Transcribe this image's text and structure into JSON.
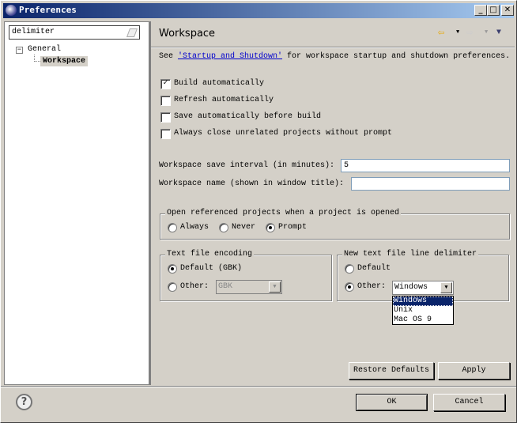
{
  "window": {
    "title": "Preferences",
    "minimize": "_",
    "maximize": "□",
    "close": "✕"
  },
  "sidebar": {
    "filter_value": "delimiter",
    "tree": [
      {
        "label": "General",
        "expanded": true,
        "toggle": "−",
        "children": [
          {
            "label": "Workspace",
            "selected": true
          }
        ]
      }
    ]
  },
  "page": {
    "title": "Workspace",
    "nav_back_icon": "back-arrow-icon",
    "nav_forward_icon": "forward-arrow-icon",
    "menu_icon": "view-menu-icon",
    "intro_prefix": "See ",
    "intro_link": "'Startup and Shutdown'",
    "intro_suffix": " for workspace startup and shutdown preferences.",
    "checkboxes": [
      {
        "label": "Build automatically",
        "checked": true
      },
      {
        "label": "Refresh automatically",
        "checked": false
      },
      {
        "label": "Save automatically before build",
        "checked": false
      },
      {
        "label": "Always close unrelated projects without prompt",
        "checked": false
      }
    ],
    "save_interval_label": "Workspace save interval (in minutes):",
    "save_interval_value": "5",
    "workspace_name_label": "Workspace name (shown in window title):",
    "workspace_name_value": "",
    "open_projects": {
      "title": "Open referenced projects when a project is opened",
      "options": [
        "Always",
        "Never",
        "Prompt"
      ],
      "selected": "Prompt"
    },
    "encoding": {
      "title": "Text file encoding",
      "default_label": "Default (GBK)",
      "other_label": "Other:",
      "other_value": "GBK",
      "selected": "Default"
    },
    "delimiter": {
      "title": "New text file line delimiter",
      "default_label": "Default",
      "other_label": "Other:",
      "other_value": "Windows",
      "selected": "Other",
      "options": [
        "Windows",
        "Unix",
        "Mac OS 9"
      ],
      "highlighted": "Windows"
    },
    "restore_defaults": "Restore Defaults",
    "apply": "Apply"
  },
  "footer": {
    "help_icon": "?",
    "ok": "OK",
    "cancel": "Cancel"
  },
  "colors": {
    "title_start": "#0a246a",
    "title_end": "#a6caf0",
    "selection": "#0a246a",
    "link": "#0000cc"
  }
}
